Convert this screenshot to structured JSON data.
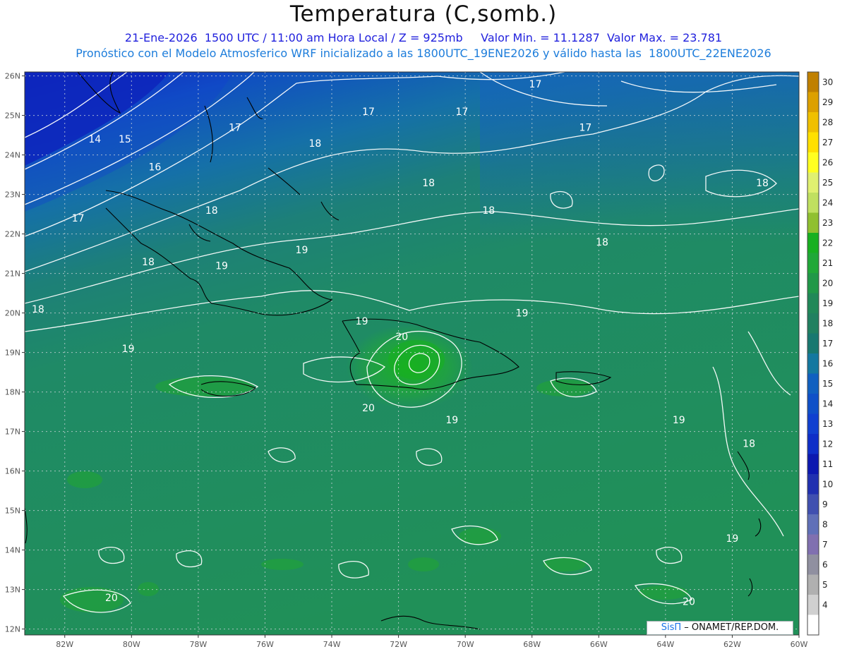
{
  "title": "Temperatura (C,somb.)",
  "subtitle_line1": "21-Ene-2026  1500 UTC / 11:00 am Hora Local / Z = 925mb     Valor Min. = 11.1287  Valor Max. = 23.781",
  "subtitle_line2": "Pronóstico con el Modelo Atmosferico WRF inicializado a las 1800UTC_19ENE2026 y válido hasta las  1800UTC_22ENE2026",
  "credit": {
    "brand": "SisΠ",
    "text": "– ONAMET/REP.DOM."
  },
  "map": {
    "lat_labels": [
      "26N",
      "25N",
      "24N",
      "23N",
      "22N",
      "21N",
      "20N",
      "19N",
      "18N",
      "17N",
      "16N",
      "15N",
      "14N",
      "13N",
      "12N"
    ],
    "lon_labels": [
      "82W",
      "80W",
      "78W",
      "76W",
      "74W",
      "72W",
      "70W",
      "68W",
      "66W",
      "64W",
      "62W",
      "60W"
    ],
    "contour_labels": [
      {
        "text": "17",
        "lon": -67.9,
        "lat": 25.8
      },
      {
        "text": "17",
        "lon": -72.9,
        "lat": 25.1
      },
      {
        "text": "17",
        "lon": -70.1,
        "lat": 25.1
      },
      {
        "text": "17",
        "lon": -76.9,
        "lat": 24.7
      },
      {
        "text": "17",
        "lon": -66.4,
        "lat": 24.7
      },
      {
        "text": "14",
        "lon": -81.1,
        "lat": 24.4
      },
      {
        "text": "15",
        "lon": -80.2,
        "lat": 24.4
      },
      {
        "text": "18",
        "lon": -74.5,
        "lat": 24.3
      },
      {
        "text": "16",
        "lon": -79.3,
        "lat": 23.7
      },
      {
        "text": "18",
        "lon": -71.1,
        "lat": 23.3
      },
      {
        "text": "18",
        "lon": -61.1,
        "lat": 23.3
      },
      {
        "text": "18",
        "lon": -77.6,
        "lat": 22.6
      },
      {
        "text": "18",
        "lon": -69.3,
        "lat": 22.6
      },
      {
        "text": "17",
        "lon": -81.6,
        "lat": 22.4
      },
      {
        "text": "18",
        "lon": -65.9,
        "lat": 21.8
      },
      {
        "text": "19",
        "lon": -74.9,
        "lat": 21.6
      },
      {
        "text": "18",
        "lon": -79.5,
        "lat": 21.3
      },
      {
        "text": "19",
        "lon": -77.3,
        "lat": 21.2
      },
      {
        "text": "18",
        "lon": -82.8,
        "lat": 20.1
      },
      {
        "text": "19",
        "lon": -68.3,
        "lat": 20.0
      },
      {
        "text": "19",
        "lon": -73.1,
        "lat": 19.8
      },
      {
        "text": "20",
        "lon": -71.9,
        "lat": 19.4
      },
      {
        "text": "19",
        "lon": -80.1,
        "lat": 19.1
      },
      {
        "text": "20",
        "lon": -72.9,
        "lat": 17.6
      },
      {
        "text": "19",
        "lon": -70.4,
        "lat": 17.3
      },
      {
        "text": "19",
        "lon": -63.6,
        "lat": 17.3
      },
      {
        "text": "18",
        "lon": -61.5,
        "lat": 16.7
      },
      {
        "text": "19",
        "lon": -62.0,
        "lat": 14.3
      },
      {
        "text": "20",
        "lon": -80.6,
        "lat": 12.8
      },
      {
        "text": "20",
        "lon": -63.3,
        "lat": 12.7
      }
    ]
  },
  "colorbar": {
    "labels": [
      "30",
      "29",
      "28",
      "27",
      "26",
      "25",
      "24",
      "23",
      "22",
      "21",
      "20",
      "19",
      "18",
      "17",
      "16",
      "15",
      "14",
      "13",
      "12",
      "11",
      "10",
      "9",
      "8",
      "7",
      "6",
      "5",
      "4"
    ],
    "colors": [
      "#c08000",
      "#dca000",
      "#f0c000",
      "#ffe000",
      "#ffff20",
      "#e0f070",
      "#c0e060",
      "#90c030",
      "#18b020",
      "#20a838",
      "#209848",
      "#208858",
      "#208060",
      "#187870",
      "#1478a0",
      "#1060c0",
      "#0f50c8",
      "#1040d0",
      "#0e2ec8",
      "#0c18b0",
      "#2030b0",
      "#4050b0",
      "#6070b8",
      "#8070b0",
      "#9090a0",
      "#b0b0b0",
      "#d0d0d0",
      "#ffffff"
    ]
  }
}
